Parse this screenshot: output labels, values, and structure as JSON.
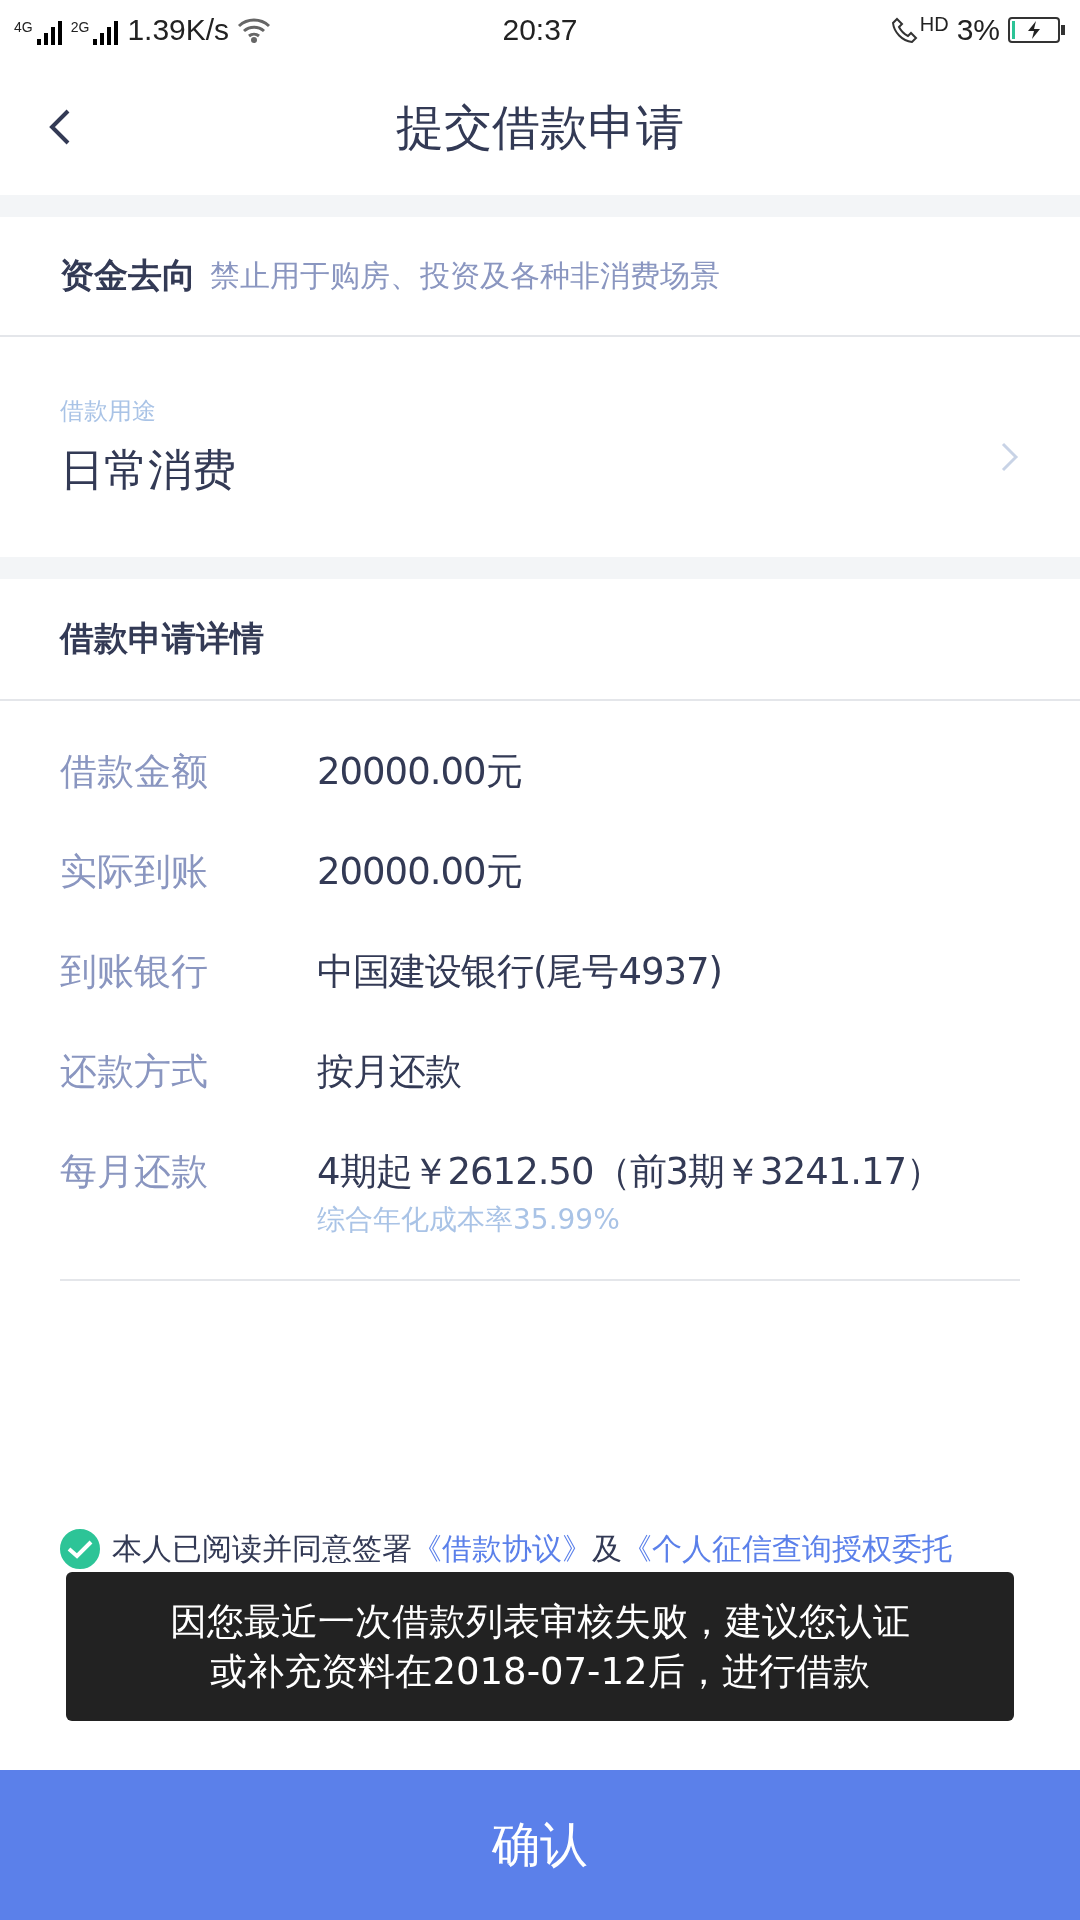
{
  "status_bar": {
    "network_1": "4G",
    "network_2": "2G",
    "speed": "1.39K/s",
    "time": "20:37",
    "hd": "HD",
    "battery": "3%"
  },
  "header": {
    "title": "提交借款申请"
  },
  "fund_direction": {
    "label": "资金去向",
    "note": "禁止用于购房、投资及各种非消费场景"
  },
  "purpose": {
    "label": "借款用途",
    "value": "日常消费"
  },
  "details": {
    "title": "借款申请详情",
    "rows": [
      {
        "label": "借款金额",
        "value": "20000.00元"
      },
      {
        "label": "实际到账",
        "value": "20000.00元"
      },
      {
        "label": "到账银行",
        "value": "中国建设银行(尾号4937)"
      },
      {
        "label": "还款方式",
        "value": "按月还款"
      },
      {
        "label": "每月还款",
        "value": "4期起￥2612.50（前3期￥3241.17）",
        "sub": "综合年化成本率35.99%"
      }
    ]
  },
  "agreement": {
    "checked": true,
    "text": "本人已阅读并同意签署",
    "link_1": "《借款协议》",
    "joiner": "及",
    "link_2": "《个人征信查询授权委托"
  },
  "toast": {
    "lines": [
      "因您最近一次借款列表审核失败，建议您认证",
      "或补充资料在2018-07-12后，进行借款"
    ]
  },
  "confirm_button": "确认"
}
